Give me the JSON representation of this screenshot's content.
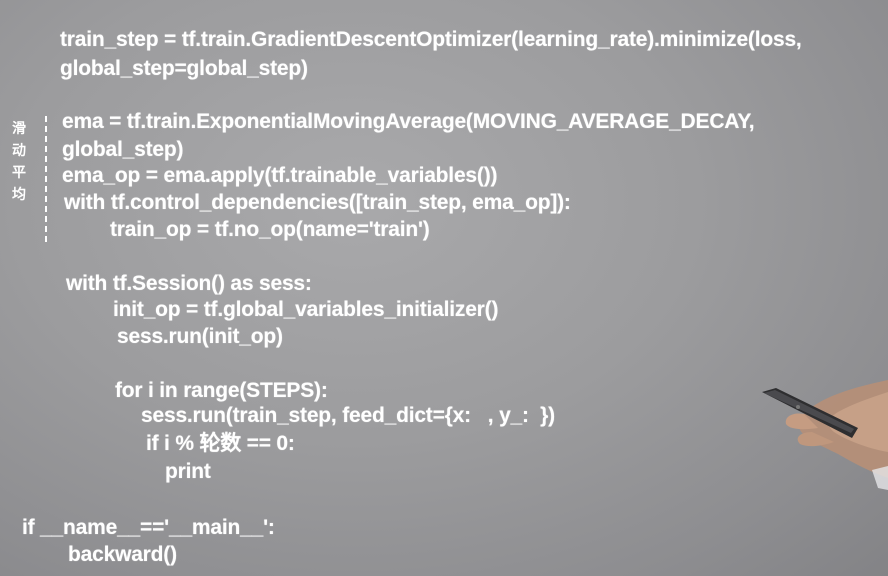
{
  "side_note": "滑动平均",
  "code_lines": [
    "train_step = tf.train.GradientDescentOptimizer(learning_rate).minimize(loss,",
    "global_step=global_step)",
    "ema = tf.train.ExponentialMovingAverage(MOVING_AVERAGE_DECAY,",
    "global_step)",
    "ema_op = ema.apply(tf.trainable_variables())",
    "with tf.control_dependencies([train_step, ema_op]):",
    "train_op = tf.no_op(name='train')",
    "with tf.Session() as sess:",
    "init_op = tf.global_variables_initializer()",
    "sess.run(init_op)",
    "for i in range(STEPS):",
    "sess.run(train_step, feed_dict={x:   , y_:  })",
    "if i % 轮数 == 0:",
    "print",
    "if __name__=='__main__':",
    "backward()"
  ]
}
